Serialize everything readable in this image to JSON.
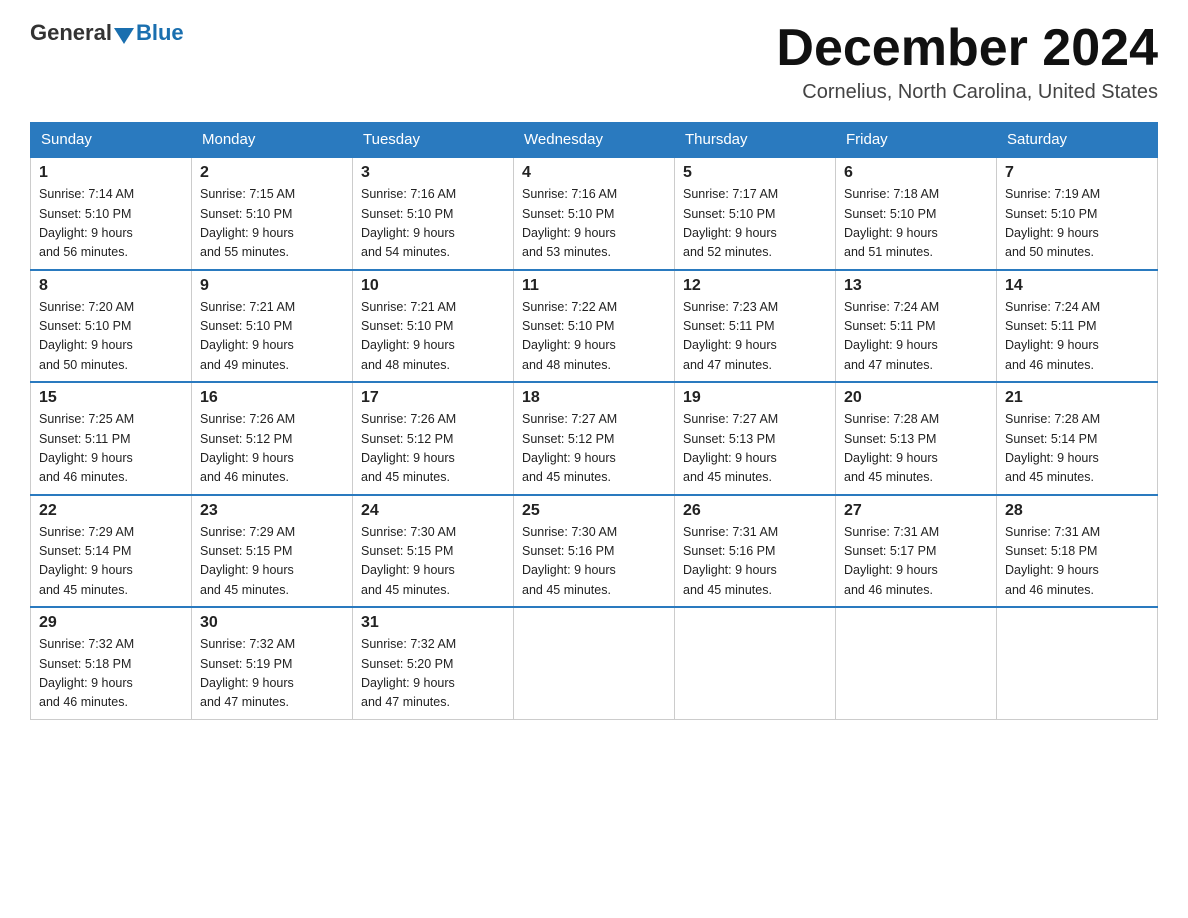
{
  "header": {
    "logo_general": "General",
    "logo_blue": "Blue",
    "month_title": "December 2024",
    "subtitle": "Cornelius, North Carolina, United States"
  },
  "days_of_week": [
    "Sunday",
    "Monday",
    "Tuesday",
    "Wednesday",
    "Thursday",
    "Friday",
    "Saturday"
  ],
  "weeks": [
    [
      {
        "day": "1",
        "sunrise": "7:14 AM",
        "sunset": "5:10 PM",
        "daylight": "9 hours and 56 minutes."
      },
      {
        "day": "2",
        "sunrise": "7:15 AM",
        "sunset": "5:10 PM",
        "daylight": "9 hours and 55 minutes."
      },
      {
        "day": "3",
        "sunrise": "7:16 AM",
        "sunset": "5:10 PM",
        "daylight": "9 hours and 54 minutes."
      },
      {
        "day": "4",
        "sunrise": "7:16 AM",
        "sunset": "5:10 PM",
        "daylight": "9 hours and 53 minutes."
      },
      {
        "day": "5",
        "sunrise": "7:17 AM",
        "sunset": "5:10 PM",
        "daylight": "9 hours and 52 minutes."
      },
      {
        "day": "6",
        "sunrise": "7:18 AM",
        "sunset": "5:10 PM",
        "daylight": "9 hours and 51 minutes."
      },
      {
        "day": "7",
        "sunrise": "7:19 AM",
        "sunset": "5:10 PM",
        "daylight": "9 hours and 50 minutes."
      }
    ],
    [
      {
        "day": "8",
        "sunrise": "7:20 AM",
        "sunset": "5:10 PM",
        "daylight": "9 hours and 50 minutes."
      },
      {
        "day": "9",
        "sunrise": "7:21 AM",
        "sunset": "5:10 PM",
        "daylight": "9 hours and 49 minutes."
      },
      {
        "day": "10",
        "sunrise": "7:21 AM",
        "sunset": "5:10 PM",
        "daylight": "9 hours and 48 minutes."
      },
      {
        "day": "11",
        "sunrise": "7:22 AM",
        "sunset": "5:10 PM",
        "daylight": "9 hours and 48 minutes."
      },
      {
        "day": "12",
        "sunrise": "7:23 AM",
        "sunset": "5:11 PM",
        "daylight": "9 hours and 47 minutes."
      },
      {
        "day": "13",
        "sunrise": "7:24 AM",
        "sunset": "5:11 PM",
        "daylight": "9 hours and 47 minutes."
      },
      {
        "day": "14",
        "sunrise": "7:24 AM",
        "sunset": "5:11 PM",
        "daylight": "9 hours and 46 minutes."
      }
    ],
    [
      {
        "day": "15",
        "sunrise": "7:25 AM",
        "sunset": "5:11 PM",
        "daylight": "9 hours and 46 minutes."
      },
      {
        "day": "16",
        "sunrise": "7:26 AM",
        "sunset": "5:12 PM",
        "daylight": "9 hours and 46 minutes."
      },
      {
        "day": "17",
        "sunrise": "7:26 AM",
        "sunset": "5:12 PM",
        "daylight": "9 hours and 45 minutes."
      },
      {
        "day": "18",
        "sunrise": "7:27 AM",
        "sunset": "5:12 PM",
        "daylight": "9 hours and 45 minutes."
      },
      {
        "day": "19",
        "sunrise": "7:27 AM",
        "sunset": "5:13 PM",
        "daylight": "9 hours and 45 minutes."
      },
      {
        "day": "20",
        "sunrise": "7:28 AM",
        "sunset": "5:13 PM",
        "daylight": "9 hours and 45 minutes."
      },
      {
        "day": "21",
        "sunrise": "7:28 AM",
        "sunset": "5:14 PM",
        "daylight": "9 hours and 45 minutes."
      }
    ],
    [
      {
        "day": "22",
        "sunrise": "7:29 AM",
        "sunset": "5:14 PM",
        "daylight": "9 hours and 45 minutes."
      },
      {
        "day": "23",
        "sunrise": "7:29 AM",
        "sunset": "5:15 PM",
        "daylight": "9 hours and 45 minutes."
      },
      {
        "day": "24",
        "sunrise": "7:30 AM",
        "sunset": "5:15 PM",
        "daylight": "9 hours and 45 minutes."
      },
      {
        "day": "25",
        "sunrise": "7:30 AM",
        "sunset": "5:16 PM",
        "daylight": "9 hours and 45 minutes."
      },
      {
        "day": "26",
        "sunrise": "7:31 AM",
        "sunset": "5:16 PM",
        "daylight": "9 hours and 45 minutes."
      },
      {
        "day": "27",
        "sunrise": "7:31 AM",
        "sunset": "5:17 PM",
        "daylight": "9 hours and 46 minutes."
      },
      {
        "day": "28",
        "sunrise": "7:31 AM",
        "sunset": "5:18 PM",
        "daylight": "9 hours and 46 minutes."
      }
    ],
    [
      {
        "day": "29",
        "sunrise": "7:32 AM",
        "sunset": "5:18 PM",
        "daylight": "9 hours and 46 minutes."
      },
      {
        "day": "30",
        "sunrise": "7:32 AM",
        "sunset": "5:19 PM",
        "daylight": "9 hours and 47 minutes."
      },
      {
        "day": "31",
        "sunrise": "7:32 AM",
        "sunset": "5:20 PM",
        "daylight": "9 hours and 47 minutes."
      },
      null,
      null,
      null,
      null
    ]
  ],
  "labels": {
    "sunrise": "Sunrise:",
    "sunset": "Sunset:",
    "daylight": "Daylight:"
  }
}
